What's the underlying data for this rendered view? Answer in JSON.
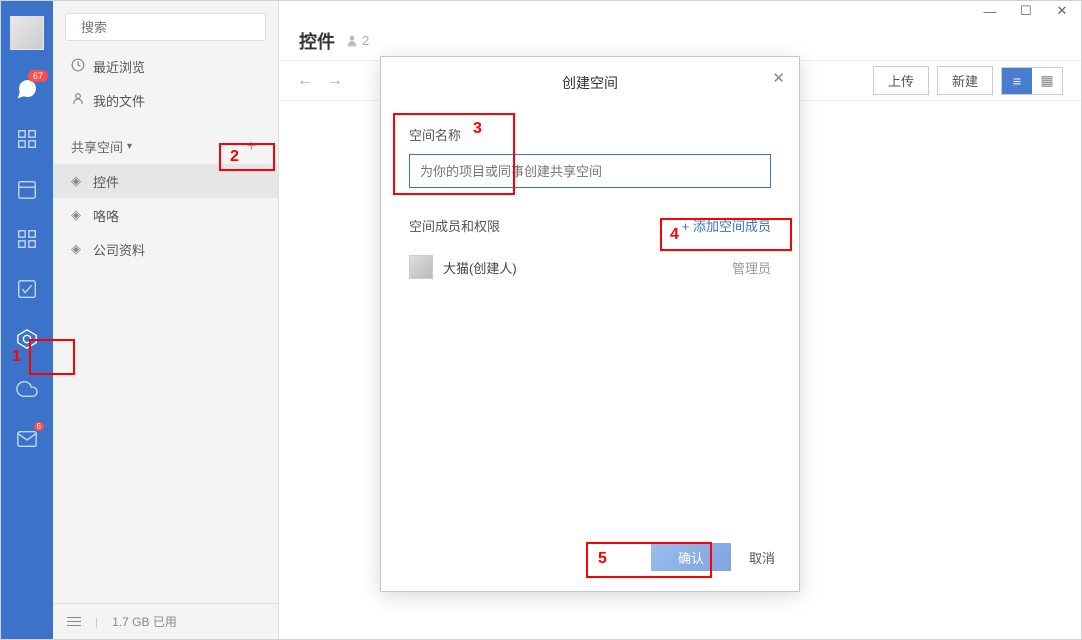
{
  "rail": {
    "chat_badge": "67",
    "mail_badge": "6"
  },
  "sidebar": {
    "search_placeholder": "搜索",
    "nav": {
      "recent": "最近浏览",
      "my_files": "我的文件"
    },
    "section_title": "共享空间",
    "items": [
      {
        "label": "控件"
      },
      {
        "label": "咯咯"
      },
      {
        "label": "公司资料"
      }
    ],
    "storage": "1.7 GB 已用"
  },
  "header": {
    "title": "控件",
    "member_count": "2"
  },
  "toolbar": {
    "upload": "上传",
    "create": "新建"
  },
  "dialog": {
    "title": "创建空间",
    "name_label": "空间名称",
    "name_placeholder": "为你的项目或同事创建共享空间",
    "members_label": "空间成员和权限",
    "add_member": "+ 添加空间成员",
    "member_name": "大猫(创建人)",
    "member_role": "管理员",
    "confirm": "确认",
    "cancel": "取消"
  },
  "callouts": {
    "c1": "1",
    "c2": "2",
    "c3": "3",
    "c4": "4",
    "c5": "5"
  }
}
